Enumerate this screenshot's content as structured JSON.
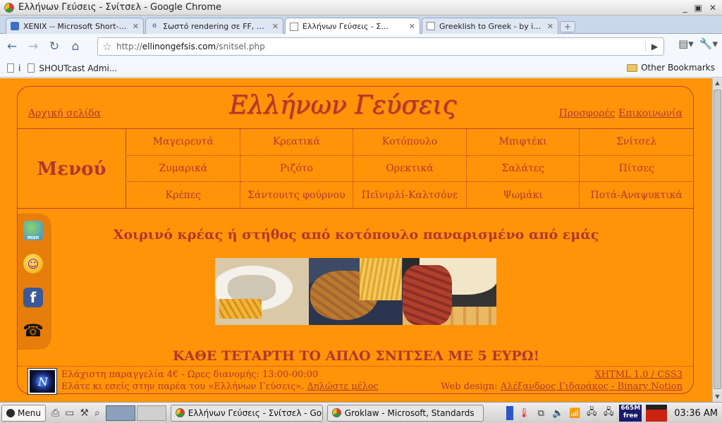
{
  "window": {
    "title": "Ελλήνων Γεύσεις - Σνίτσελ - Google Chrome",
    "controls": [
      "_",
      "▣",
      "✕"
    ]
  },
  "tabs": [
    {
      "label": "XENIX -- Microsoft Short-lived ...",
      "icon": "xenix-favicon",
      "active": false
    },
    {
      "label": "Σωστό rendering σε FF, Ch...",
      "icon": "forum-favicon",
      "active": false
    },
    {
      "label": "Ελλήνων Γεύσεις - Σ...",
      "icon": "page-favicon",
      "active": true
    },
    {
      "label": "Greeklish to Greek - by innoeti...",
      "icon": "page-favicon",
      "active": false
    }
  ],
  "toolbar": {
    "url_prefix": "http://",
    "url_domain": "ellinongefsis.com",
    "url_path": "/snitsel.php"
  },
  "bookmarks": {
    "items": [
      {
        "label": "i",
        "icon": "page-icon"
      },
      {
        "label": "SHOUTcast Admi...",
        "icon": "page-icon"
      }
    ],
    "other": "Other Bookmarks"
  },
  "site": {
    "home_link": "Αρχική σελίδα",
    "title": "Ελλήνων  Γεύσεις",
    "offers_link": "Προσφορές",
    "contact_link": "Επικοινωνία",
    "menu_label": "Μενού",
    "menu": [
      "Μαγειρευτά",
      "Κρεατικά",
      "Κοτόπουλο",
      "Μπιφτέκι",
      "Σνίτσελ",
      "Ζυμαρικά",
      "Ριζότο",
      "Ορεκτικά",
      "Σαλάτες",
      "Πίτσες",
      "Κρέπες",
      "Σάντουιτς φούρνου",
      "Πεϊνιρλί-Καλτσόνε",
      "Ψωμάκι",
      "Ποτά-Αναψυκτικά"
    ],
    "headline": "Χοιρινό κρέας ή στήθος από κοτόπουλο παναρισμένο από εμάς",
    "offer": "ΚΑΘΕ ΤΕΤΑΡΤΗ ΤΟ ΑΠΛΟ ΣΝΙΤΣΕΛ ΜΕ 5 ΕΥΡΩ!",
    "footer": {
      "line1": "Ελάχιστη παραγγελία 4€ - Ωρες διανομής: 13:00-00:00",
      "line2_text": "Ελάτε κι εσείς στην παρέα του «Ελλήνων Γεύσεις». ",
      "line2_link": "Δηλώστε μέλος",
      "standards": "XHTML 1.0 / CSS3",
      "design_label": "Web design: ",
      "design_link": "Αλέξανδρος Γιδαράκος - Binary Notion"
    }
  },
  "taskbar": {
    "start": "Menu",
    "tasks": [
      {
        "label": "Ελλήνων Γεύσεις - Σνίτσελ - Goo"
      },
      {
        "label": "Groklaw - Microsoft, Standards"
      }
    ],
    "memory": "665M free",
    "clock": "03:36 AM"
  },
  "colors": {
    "page_bg": "#ff9409",
    "accent_text": "#b3362a"
  }
}
